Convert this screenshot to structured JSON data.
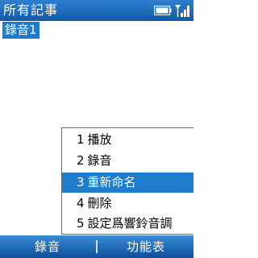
{
  "titlebar": {
    "title": "所有記事",
    "battery_icon": "battery-icon",
    "signal_icon": "signal-icon"
  },
  "list": {
    "items": [
      {
        "label": "錄音1"
      }
    ]
  },
  "menu": {
    "items": [
      {
        "num": "1",
        "label": "播放"
      },
      {
        "num": "2",
        "label": "錄音"
      },
      {
        "num": "3",
        "label": "重新命名"
      },
      {
        "num": "4",
        "label": "刪除"
      },
      {
        "num": "5",
        "label": "設定爲響鈴音調"
      }
    ],
    "selected_index": 2
  },
  "softkeys": {
    "left_label": "錄音",
    "right_label": "功能表"
  },
  "colors": {
    "accent": "#1e7ccf",
    "titlebar": "#0f5aa8"
  }
}
